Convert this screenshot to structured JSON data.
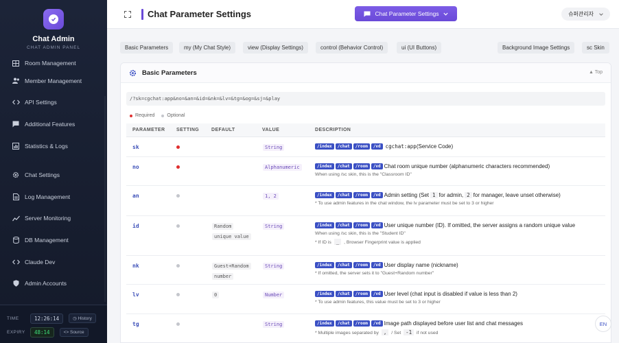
{
  "brand": {
    "title": "Chat Admin",
    "subtitle": "CHAT ADMIN PANEL"
  },
  "sidebar": {
    "items": [
      {
        "label": "Room Management",
        "icon": "room-icon"
      },
      {
        "label": "Member Management",
        "icon": "members-icon"
      },
      {
        "label": "API Settings",
        "icon": "code-icon"
      },
      {
        "label": "Additional Features",
        "icon": "chat-bubble-icon"
      },
      {
        "label": "Statistics & Logs",
        "icon": "chart-icon"
      },
      {
        "label": "Chat Settings",
        "icon": "gear-icon"
      },
      {
        "label": "Log Management",
        "icon": "document-icon"
      },
      {
        "label": "Server Monitoring",
        "icon": "line-chart-icon"
      },
      {
        "label": "DB Management",
        "icon": "database-icon"
      },
      {
        "label": "Claude Dev",
        "icon": "code-icon"
      },
      {
        "label": "Admin Accounts",
        "icon": "shield-icon"
      }
    ],
    "footer": {
      "time_label": "TIME",
      "time_value": "12:26:14",
      "history_label": "History",
      "expiry_label": "EXPIRY",
      "expiry_value": "48:14",
      "source_label": "Source"
    }
  },
  "header": {
    "title": "Chat Parameter Settings",
    "selector_label": "Chat Parameter Settings",
    "user_label": "슈퍼관리자"
  },
  "tabs": [
    {
      "label": "Basic Parameters"
    },
    {
      "label": "my (My Chat Style)"
    },
    {
      "label": "view (Display Settings)"
    },
    {
      "label": "control (Behavior Control)"
    },
    {
      "label": "ui (UI Buttons)"
    },
    {
      "label": "Background Image Settings"
    },
    {
      "label": "sc Skin"
    }
  ],
  "card": {
    "title": "Basic Parameters",
    "top_link": "▲ Top",
    "url": "/?sk=cgchat:app&no=&an=&id=&nk=&lv=&tg=&og=&sj=&play",
    "legend_required": "Required",
    "legend_optional": "Optional",
    "columns": {
      "parameter": "PARAMETER",
      "setting": "SETTING",
      "default": "DEFAULT",
      "value": "VALUE",
      "description": "DESCRIPTION"
    },
    "path_tags": [
      "/index",
      "/chat",
      "/room",
      "/vd"
    ],
    "rows": [
      {
        "param": "sk",
        "required": true,
        "default": "",
        "value": "String",
        "desc_prefix": "",
        "desc_code": "cgchat:app",
        "desc": " (Service Code)",
        "notes": []
      },
      {
        "param": "no",
        "required": true,
        "default": "",
        "value": "Alphanumeric",
        "desc": "Chat room unique number (alphanumeric characters recommended)",
        "notes": [
          "When using /sc skin, this is the \"Classroom ID\""
        ]
      },
      {
        "param": "an",
        "required": false,
        "default": "",
        "value": "1, 2",
        "desc_parts": [
          "Admin setting (Set",
          "1",
          "for admin,",
          "2",
          "for manager, leave unset otherwise)"
        ],
        "notes": [
          "* To use admin features in the chat window, the lv parameter must be set to 3 or higher"
        ]
      },
      {
        "param": "id",
        "required": false,
        "default": "Random unique value",
        "default_lines": [
          "Random",
          "unique value"
        ],
        "value": "String",
        "desc": "User unique number (ID). If omitted, the server assigns a random unique value",
        "notes": [
          "When using /sc skin, this is the \"Student ID\""
        ],
        "note2_parts": [
          "* If ID is",
          "_",
          ", Browser Fingerprint value is applied"
        ]
      },
      {
        "param": "nk",
        "required": false,
        "default": "Guest+Random number",
        "default_lines": [
          "Guest+Random",
          "number"
        ],
        "value": "String",
        "desc": "User display name (nickname)",
        "notes": [
          "* If omitted, the server sets it to \"Guest+Random number\""
        ]
      },
      {
        "param": "lv",
        "required": false,
        "default": "0",
        "value": "Number",
        "desc": "User level (chat input is disabled if value is less than 2)",
        "notes": [
          "* To use admin features, this value must be set to 3 or higher"
        ]
      },
      {
        "param": "tg",
        "required": false,
        "default": "",
        "value": "String",
        "desc": "Image path displayed before user list and chat messages",
        "note_parts": [
          "* Multiple images separated by",
          ",",
          "/ Set",
          "-1",
          "if not used"
        ]
      }
    ]
  },
  "en_button": "EN",
  "colors": {
    "accent": "#6a4ad8",
    "sidebar_bg": "#1c2438",
    "required": "#e03030",
    "tag": "#3b50c4"
  }
}
